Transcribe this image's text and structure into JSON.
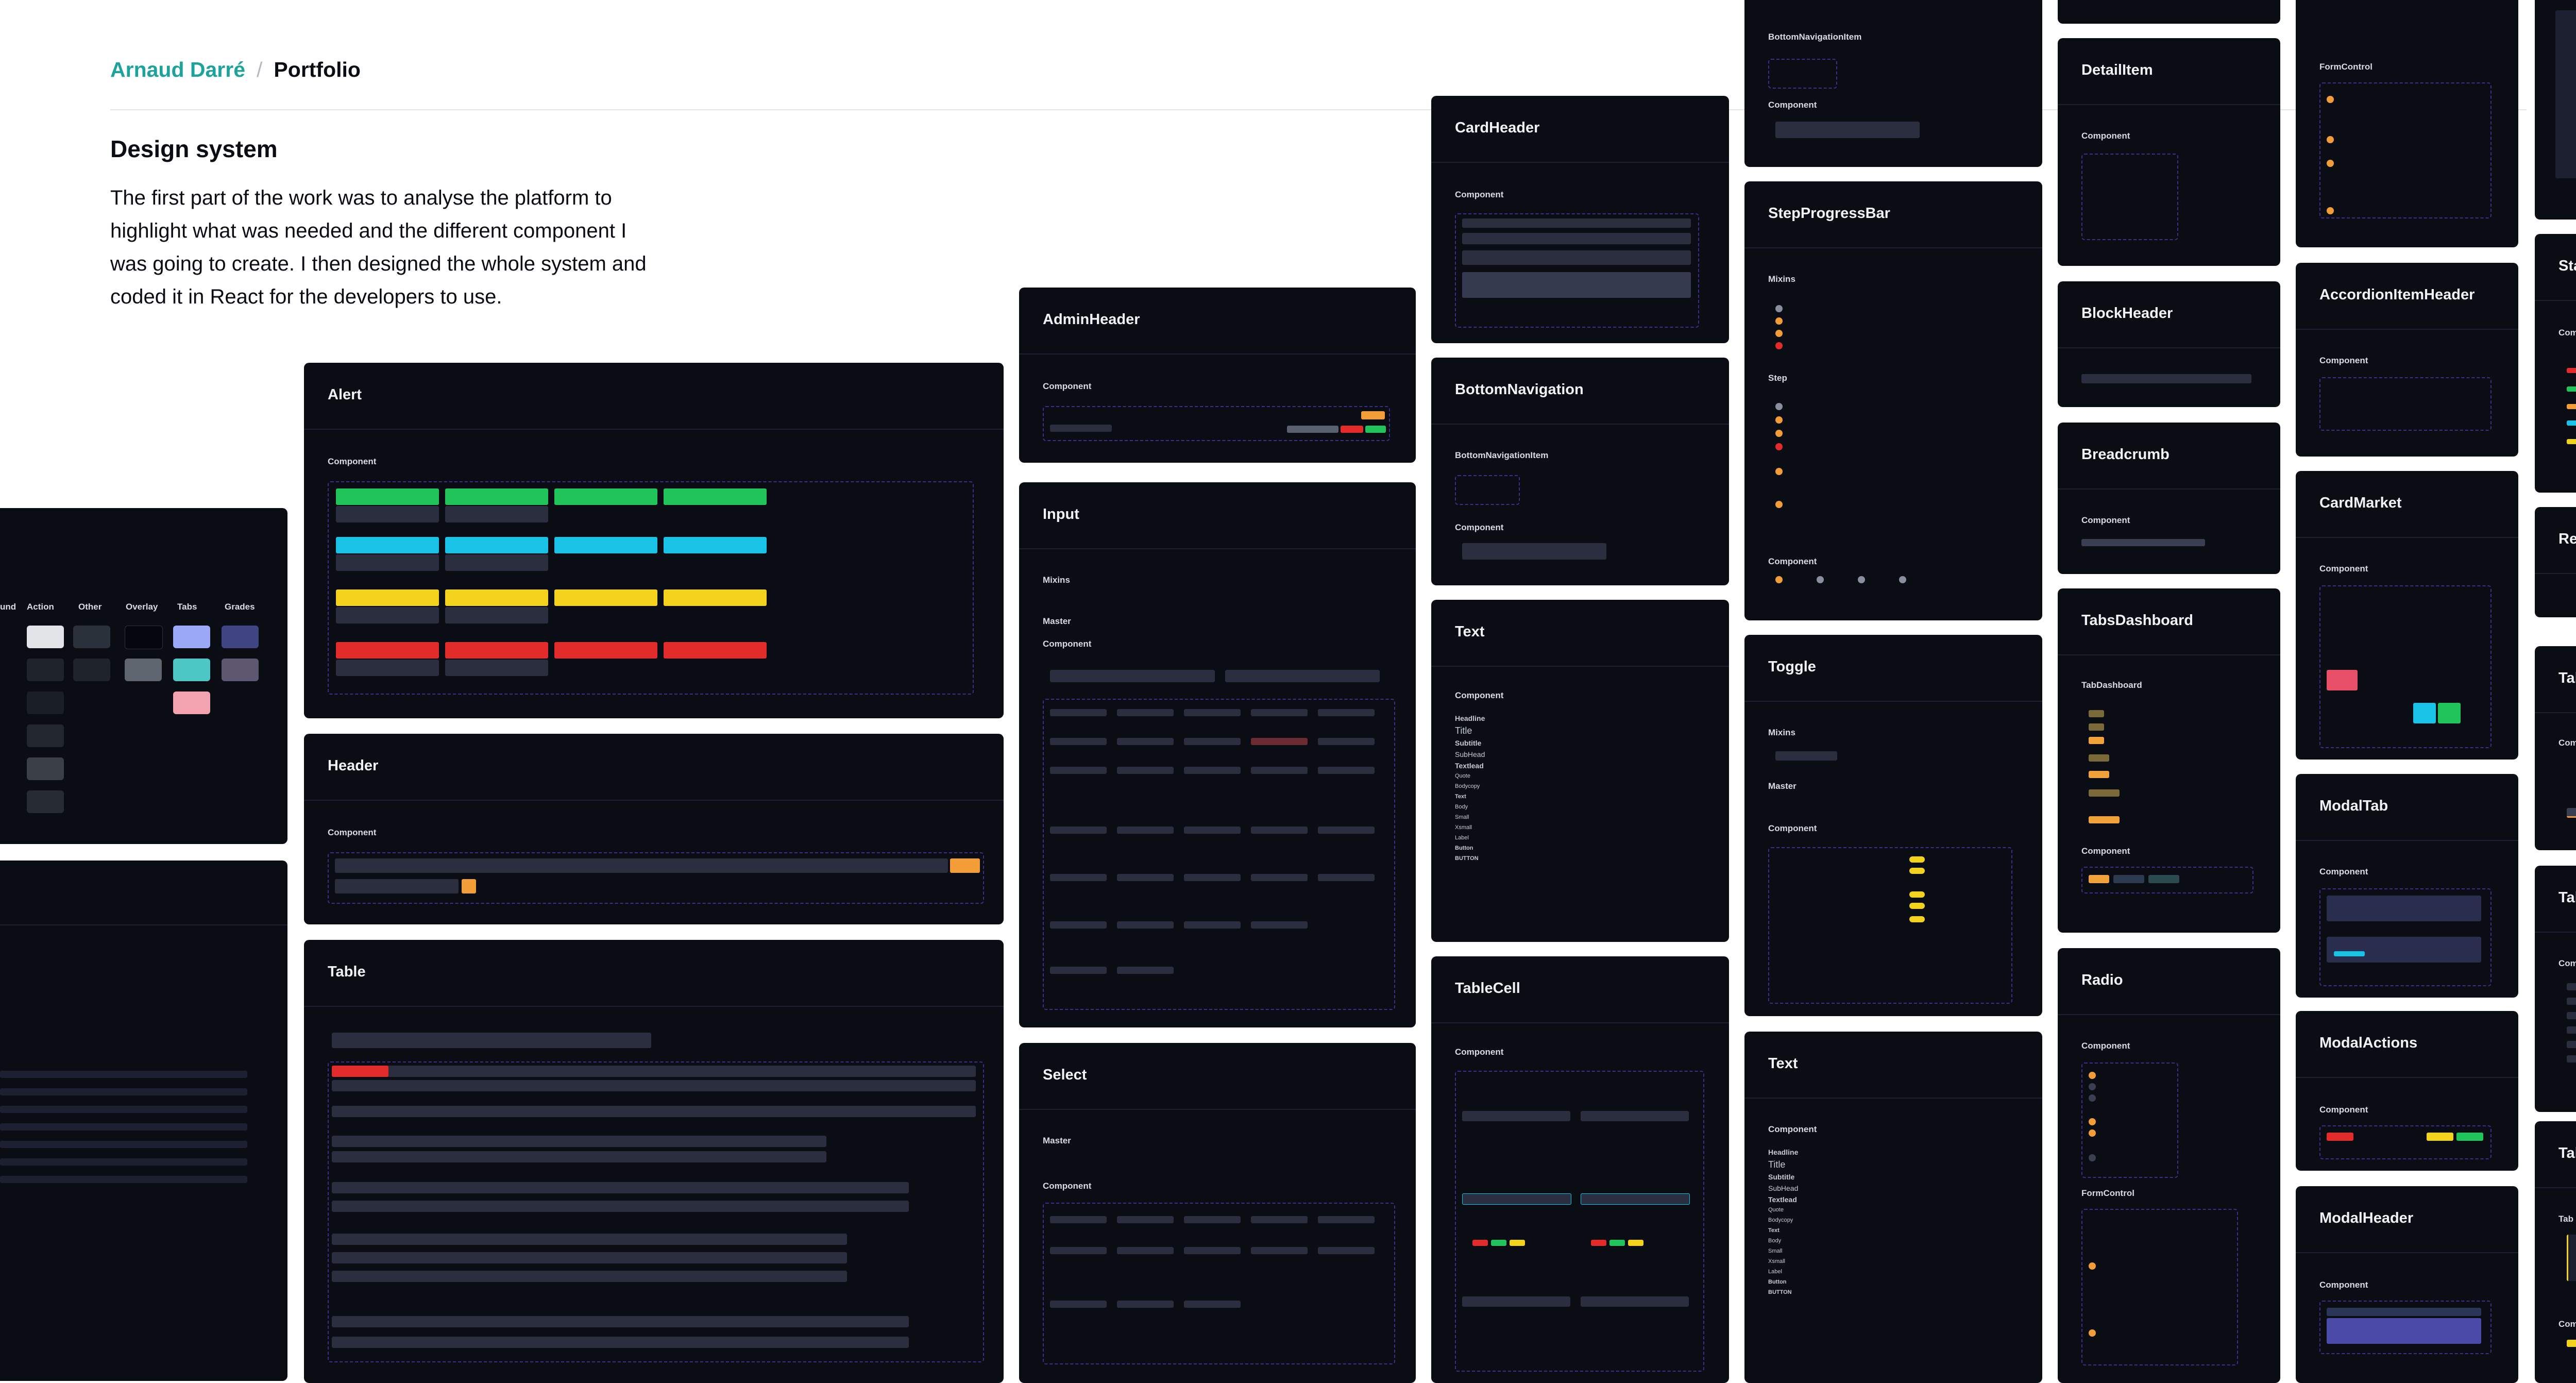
{
  "breadcrumb": {
    "author": "Arnaud Darré",
    "separator": "/",
    "current": "Portfolio"
  },
  "intro": {
    "title": "Design system",
    "body": "The first part of the work was to analyse the platform to highlight what was needed and the different component I was going to create. I then designed the whole system and coded it in React for the developers to use."
  },
  "labels": {
    "component": "Component",
    "mixins": "Mixins",
    "master": "Master",
    "step": "Step",
    "form_control": "FormControl",
    "tab": "Tab"
  },
  "cards": {
    "alert": "Alert",
    "header": "Header",
    "table": "Table",
    "admin_header": "AdminHeader",
    "input": "Input",
    "select": "Select",
    "card_header": "CardHeader",
    "bottom_navigation": "BottomNavigation",
    "text": "Text",
    "table_cell": "TableCell",
    "step_progress_bar": "StepProgressBar",
    "toggle": "Toggle",
    "text2": "Text",
    "detail_item": "DetailItem",
    "block_header": "BlockHeader",
    "breadcrumb": "Breadcrumb",
    "tabs_dashboard": "TabsDashboard",
    "radio": "Radio",
    "accordion_item_header": "AccordionItemHeader",
    "card_market": "CardMarket",
    "modal_tab": "ModalTab",
    "modal_actions": "ModalActions",
    "modal_header": "ModalHeader",
    "status": "Status",
    "resize": "Resize",
    "tab": "Tab",
    "tab_list": "TabList",
    "tabs": "Tabs"
  },
  "sublabels": {
    "bottom_navigation_item": "BottomNavigationItem",
    "tab_dashboard": "TabDashboard"
  },
  "palette_columns": [
    "und",
    "Action",
    "Other",
    "Overlay",
    "Tabs",
    "Grades"
  ],
  "text_styles": [
    "Headline",
    "Title",
    "Subtitle",
    "SubHead",
    "Textlead",
    "Quote",
    "Bodycopy",
    "Text",
    "Body",
    "Small",
    "Xsmall",
    "Label",
    "Button",
    "BUTTON"
  ],
  "colors": {
    "page_bg": "#ffffff",
    "card_bg": "#0b0d14",
    "accent_teal": "#1ea39c",
    "alert_green": "#21c45a",
    "alert_cyan": "#19c3e6",
    "alert_yellow": "#f2d21c",
    "alert_red": "#e22b2b",
    "orange": "#f29d38",
    "frame_purple": "#3b2f8c"
  }
}
